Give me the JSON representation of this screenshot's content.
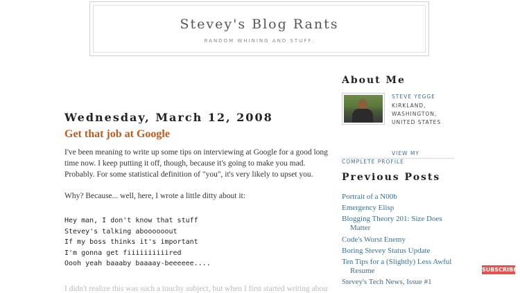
{
  "header": {
    "title": "Stevey's Blog Rants",
    "description": "RANDOM WHINING AND STUFF."
  },
  "post": {
    "date": "Wednesday, March 12, 2008",
    "title": "Get that job at Google",
    "paragraphs": [
      "I've been meaning to write up some tips on interviewing at Google for a good long time now. I keep putting it off, though, because it's going to make you mad. Probably. For some statistical definition of \"you\", it's very likely to upset you.",
      "Why? Because... well, here, I wrote a little ditty about it:"
    ],
    "ditty": [
      "Hey man, I don't know that stuff",
      "Stevey's talking aboooooout",
      "If my boss thinks it's important",
      "I'm gonna get fiiiiiiiiiired",
      "Oooh yeah baaaby baaaay-beeeeee...."
    ],
    "cutoff_line": "I didn't realize this was such a touchy subject, but when I first started writing about"
  },
  "sidebar": {
    "about_heading": "About Me",
    "profile": {
      "name": "STEVE YEGGE",
      "location": "KIRKLAND, WASHINGTON, UNITED STATES",
      "link": "VIEW MY COMPLETE PROFILE"
    },
    "previous_heading": "Previous Posts",
    "previous_posts": [
      "Portrait of a N00b",
      "Emergency Elisp",
      "Blogging Theory 201: Size Does Matter",
      "Code's Worst Enemy",
      "Boring Stevey Status Update",
      "Ten Tips for a (Slightly) Less Awful Resume",
      "Stevey's Tech News, Issue #1"
    ]
  },
  "overlay": {
    "subscribe_label": "SUBSCRIBE",
    "subscribe_color": "#e8504e"
  },
  "colors": {
    "post_title": "#c05a1b",
    "link": "#3d6e91"
  }
}
